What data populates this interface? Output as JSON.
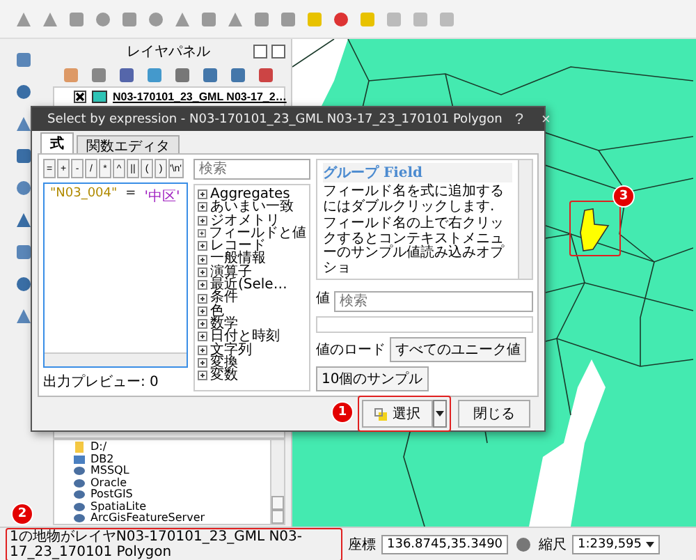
{
  "layer_panel": {
    "title": "レイヤパネル",
    "layers": [
      {
        "name": "N03-170101_23_GML N03-17_2…",
        "checked": true,
        "color": "#2ec4b6"
      }
    ],
    "browser_items": [
      {
        "label": "D:/",
        "kind": "folder"
      },
      {
        "label": "DB2",
        "kind": "db2"
      },
      {
        "label": "MSSQL",
        "kind": "db"
      },
      {
        "label": "Oracle",
        "kind": "db"
      },
      {
        "label": "PostGIS",
        "kind": "db"
      },
      {
        "label": "SpatiaLite",
        "kind": "db"
      },
      {
        "label": "ArcGisFeatureServer",
        "kind": "db"
      }
    ]
  },
  "dialog": {
    "title": "Select by expression - N03-170101_23_GML N03-17_23_170101 Polygon",
    "help_button": "?",
    "close_button": "×",
    "tabs": [
      {
        "label": "式",
        "selected": true
      },
      {
        "label": "関数エディタ",
        "selected": false
      }
    ],
    "operators": [
      "=",
      "+",
      "-",
      "/",
      "*",
      "^",
      "||",
      "(",
      ")",
      "'\\n'"
    ],
    "expression": {
      "field": "\"N03_004\"",
      "operator": "=",
      "value": "'中区'"
    },
    "search": {
      "placeholder": "検索"
    },
    "functions": [
      {
        "label": "Aggregates"
      },
      {
        "label": "あいまい一致"
      },
      {
        "label": "ジオメトリ"
      },
      {
        "label": "フィールドと値"
      },
      {
        "label": "レコード"
      },
      {
        "label": "一般情報"
      },
      {
        "label": "演算子"
      },
      {
        "label": "最近(Sele…"
      },
      {
        "label": "条件"
      },
      {
        "label": "色"
      },
      {
        "label": "数学"
      },
      {
        "label": "日付と時刻"
      },
      {
        "label": "文字列"
      },
      {
        "label": "変換"
      },
      {
        "label": "変数"
      }
    ],
    "help": {
      "heading": "グループ Field",
      "paragraphs": [
        "フィールド名を式に追加するにはダブルクリックします.",
        "フィールド名の上で右クリックするとコンテキストメニューのサンプル値読み込みオプショ"
      ]
    },
    "values_label": "値",
    "values_search": {
      "placeholder": "検索"
    },
    "load_label": "値のロード",
    "load_buttons": [
      "すべてのユニーク値",
      "10個のサンプル"
    ],
    "preview": "出力プレビュー: 0",
    "select_button": "選択",
    "close_action": "閉じる",
    "select_badge": "1"
  },
  "map": {
    "badge": "3"
  },
  "status_bar": {
    "badge": "2",
    "message": "1の地物がレイヤN03-170101_23_GML N03-17_23_170101 Polygon",
    "coordinate_label": "座標",
    "coordinate": "136.8745,35.3490",
    "scale_label": "縮尺",
    "scale": "1:239,595"
  }
}
